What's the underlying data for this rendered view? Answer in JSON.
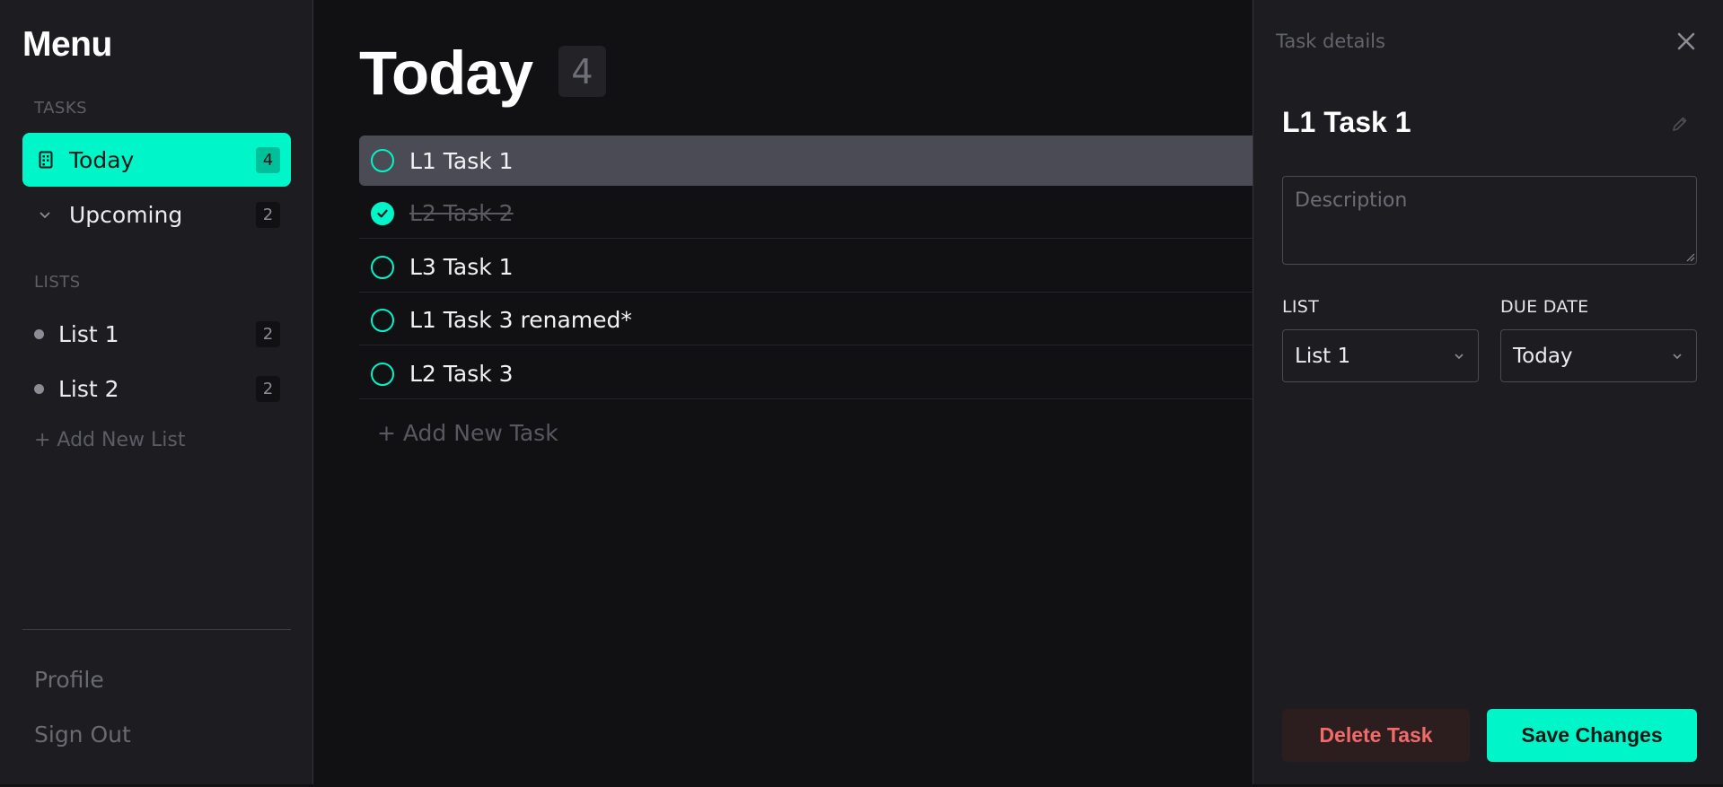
{
  "sidebar": {
    "title": "Menu",
    "tasks_section": "TASKS",
    "nav": [
      {
        "label": "Today",
        "count": "4",
        "icon": "calendar-icon",
        "active": true
      },
      {
        "label": "Upcoming",
        "count": "2",
        "icon": "chevron-down-icon",
        "active": false
      }
    ],
    "lists_section": "LISTS",
    "lists": [
      {
        "label": "List 1",
        "count": "2"
      },
      {
        "label": "List 2",
        "count": "2"
      }
    ],
    "add_list": "+ Add New List",
    "footer": {
      "profile": "Profile",
      "sign_out": "Sign Out"
    }
  },
  "main": {
    "title": "Today",
    "count": "4",
    "tasks": [
      {
        "label": "L1 Task 1",
        "done": false,
        "selected": true
      },
      {
        "label": "L2 Task 2",
        "done": true,
        "selected": false
      },
      {
        "label": "L3 Task 1",
        "done": false,
        "selected": false
      },
      {
        "label": "L1 Task 3 renamed*",
        "done": false,
        "selected": false
      },
      {
        "label": "L2 Task 3",
        "done": false,
        "selected": false
      }
    ],
    "add_task": "+ Add New Task"
  },
  "details": {
    "header": "Task details",
    "task_title": "L1 Task 1",
    "description_placeholder": "Description",
    "description_value": "",
    "list_label": "LIST",
    "list_value": "List 1",
    "due_label": "DUE DATE",
    "due_value": "Today",
    "delete_label": "Delete Task",
    "save_label": "Save Changes"
  },
  "colors": {
    "accent": "#00f5c8",
    "background": "#111114",
    "panel": "#1c1c21",
    "selected_row": "#4b4b55",
    "danger": "#f26b6b"
  }
}
